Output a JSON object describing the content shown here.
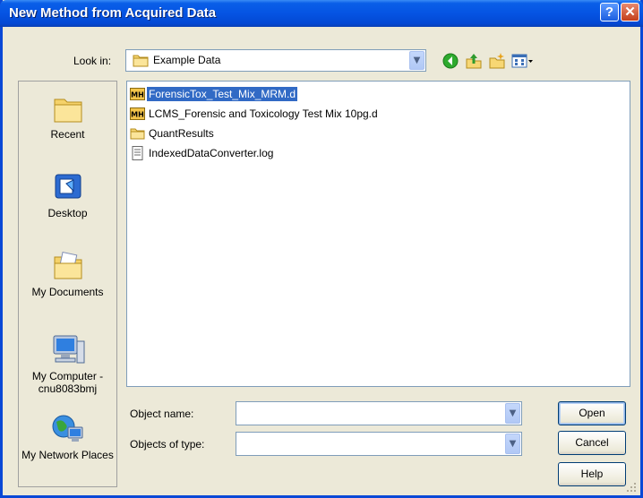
{
  "window": {
    "title": "New Method from Acquired Data"
  },
  "titlebar": {
    "help_glyph": "?",
    "close_glyph": "✕"
  },
  "look_in": {
    "label": "Look in:",
    "value": "Example Data",
    "arrow": "▼"
  },
  "toolbar": {
    "icons": [
      "back-icon",
      "up-folder-icon",
      "new-folder-icon",
      "views-menu-icon"
    ]
  },
  "places": [
    {
      "label": "Recent",
      "icon": "recent-folder-icon"
    },
    {
      "label": "Desktop",
      "icon": "desktop-icon"
    },
    {
      "label": "My Documents",
      "icon": "my-documents-icon"
    },
    {
      "label": "My Computer - cnu8083bmj",
      "icon": "my-computer-icon"
    },
    {
      "label": "My Network Places",
      "icon": "network-icon"
    }
  ],
  "files": [
    {
      "name": "ForensicTox_Test_Mix_MRM.d",
      "icon": "masshunter-data-icon",
      "selected": true
    },
    {
      "name": "LCMS_Forensic and Toxicology Test Mix 10pg.d",
      "icon": "masshunter-data-icon",
      "selected": false
    },
    {
      "name": "QuantResults",
      "icon": "folder-icon",
      "selected": false
    },
    {
      "name": "IndexedDataConverter.log",
      "icon": "text-file-icon",
      "selected": false
    }
  ],
  "object_name": {
    "label": "Object name:",
    "value": ""
  },
  "object_type": {
    "label": "Objects of type:",
    "value": ""
  },
  "buttons": {
    "open": "Open",
    "cancel": "Cancel",
    "help": "Help"
  },
  "mh_badge": "MH",
  "colors": {
    "selection": "#316ac5",
    "titlebar": "#0554e3",
    "dialog_bg": "#ece9d8"
  }
}
